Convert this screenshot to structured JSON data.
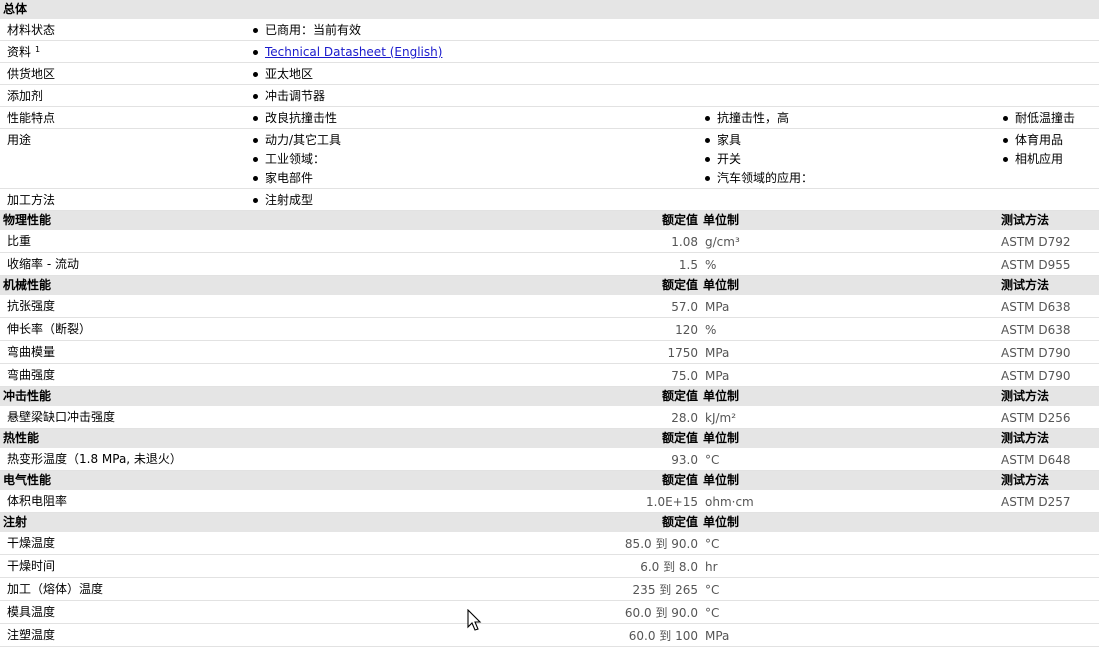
{
  "general": {
    "title": "总体",
    "rows": [
      {
        "label": "材料状态",
        "items": [
          "已商用：当前有效"
        ]
      },
      {
        "label": "资料",
        "sup": "1",
        "link": "Technical Datasheet (English)"
      },
      {
        "label": "供货地区",
        "items": [
          "亚太地区"
        ]
      },
      {
        "label": "添加剂",
        "items": [
          "冲击调节器"
        ]
      },
      {
        "label": "性能特点",
        "cols": [
          [
            "改良抗撞击性"
          ],
          [
            "抗撞击性，高"
          ],
          [
            "耐低温撞击"
          ]
        ]
      },
      {
        "label": "用途",
        "cols": [
          [
            "动力/其它工具",
            "工业领域：",
            "家电部件"
          ],
          [
            "家具",
            "开关",
            "汽车领域的应用："
          ],
          [
            "体育用品",
            "相机应用"
          ]
        ]
      },
      {
        "label": "加工方法",
        "items": [
          "注射成型"
        ]
      }
    ]
  },
  "headers": {
    "nominal": "额定值",
    "unit": "单位制",
    "method": "测试方法"
  },
  "sections": [
    {
      "title": "物理性能",
      "has_method": true,
      "rows": [
        {
          "label": "比重",
          "value": "1.08",
          "unit": "g/cm³",
          "method": "ASTM D792"
        },
        {
          "label": "收缩率 - 流动",
          "value": "1.5",
          "unit": "%",
          "method": "ASTM D955"
        }
      ]
    },
    {
      "title": "机械性能",
      "has_method": true,
      "rows": [
        {
          "label": "抗张强度",
          "value": "57.0",
          "unit": "MPa",
          "method": "ASTM D638"
        },
        {
          "label": "伸长率（断裂）",
          "value": "120",
          "unit": "%",
          "method": "ASTM D638"
        },
        {
          "label": "弯曲模量",
          "value": "1750",
          "unit": "MPa",
          "method": "ASTM D790"
        },
        {
          "label": "弯曲强度",
          "value": "75.0",
          "unit": "MPa",
          "method": "ASTM D790"
        }
      ]
    },
    {
      "title": "冲击性能",
      "has_method": true,
      "rows": [
        {
          "label": "悬壁梁缺口冲击强度",
          "value": "28.0",
          "unit": "kJ/m²",
          "method": "ASTM D256"
        }
      ]
    },
    {
      "title": "热性能",
      "has_method": true,
      "rows": [
        {
          "label": "热变形温度（1.8 MPa, 未退火）",
          "value": "93.0",
          "unit": "°C",
          "method": "ASTM D648"
        }
      ]
    },
    {
      "title": "电气性能",
      "has_method": true,
      "rows": [
        {
          "label": "体积电阻率",
          "value": "1.0E+15",
          "unit": "ohm·cm",
          "method": "ASTM D257"
        }
      ]
    },
    {
      "title": "注射",
      "has_method": false,
      "rows": [
        {
          "label": "干燥温度",
          "value": "85.0 到  90.0",
          "unit": "°C"
        },
        {
          "label": "干燥时间",
          "value": "6.0 到  8.0",
          "unit": "hr"
        },
        {
          "label": "加工（熔体）温度",
          "value": "235 到  265",
          "unit": "°C"
        },
        {
          "label": "模具温度",
          "value": "60.0 到  90.0",
          "unit": "°C"
        },
        {
          "label": "注塑温度",
          "value": "60.0 到  100",
          "unit": "MPa"
        }
      ]
    }
  ]
}
